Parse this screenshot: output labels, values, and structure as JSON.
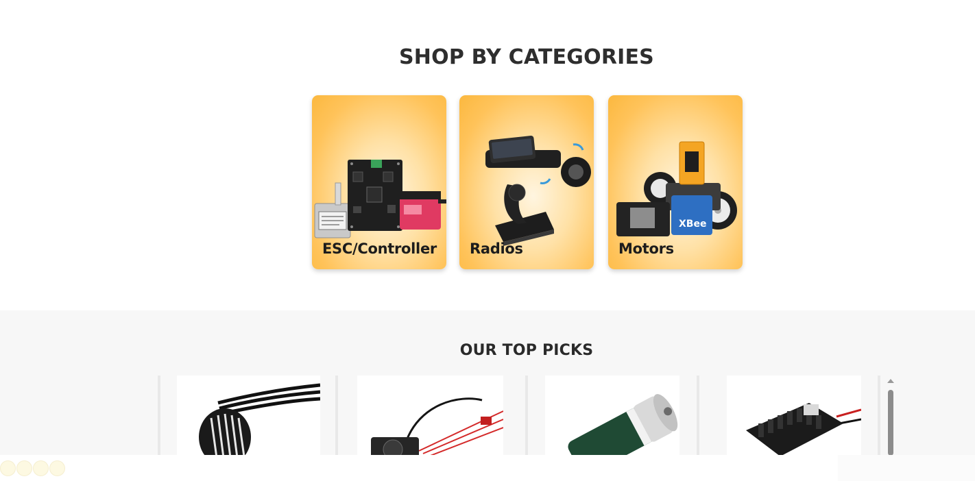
{
  "categories_section": {
    "title": "SHOP BY CATEGORIES",
    "cards": [
      {
        "label": "ESC/Controller",
        "image_icon": "esc-controller-board-image"
      },
      {
        "label": "Radios",
        "image_icon": "radio-transmitter-image"
      },
      {
        "label": "Motors",
        "image_icon": "robot-car-kit-image"
      }
    ]
  },
  "top_picks_section": {
    "title": "OUR TOP PICKS",
    "items": [
      {
        "image_icon": "brushless-motor-image"
      },
      {
        "image_icon": "esc-with-fan-image"
      },
      {
        "image_icon": "dc-motor-image"
      },
      {
        "image_icon": "heatsink-esc-image"
      }
    ]
  },
  "colors": {
    "card_gradient_outer": "#fbb83f",
    "card_gradient_inner": "#fff5e0",
    "picks_background": "#f7f7f7"
  }
}
